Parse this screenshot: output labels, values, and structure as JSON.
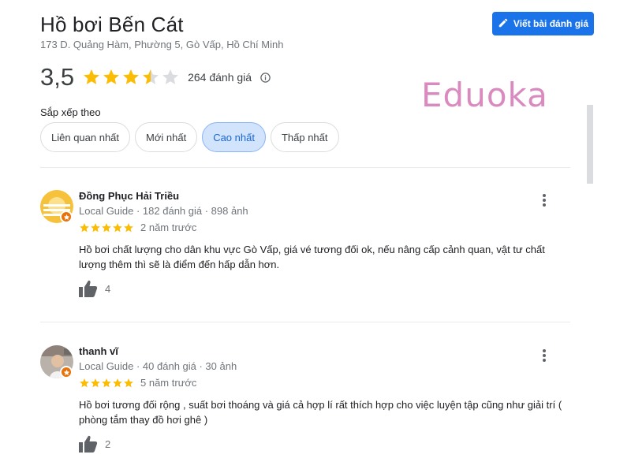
{
  "place": {
    "title": "Hồ bơi Bến Cát",
    "address": "173 D. Quảng Hàm, Phường 5, Gò Vấp, Hồ Chí Minh",
    "write_review_label": "Viết bài đánh giá"
  },
  "summary": {
    "rating": "3,5",
    "rating_value": 3.5,
    "review_count_label": "264 đánh giá"
  },
  "watermark": "Eduoka",
  "sort": {
    "label": "Sắp xếp theo",
    "options": [
      "Liên quan nhất",
      "Mới nhất",
      "Cao nhất",
      "Thấp nhất"
    ],
    "selected": "Cao nhất"
  },
  "reviews": [
    {
      "name": "Đồng Phục Hải Triều",
      "meta": "Local Guide · 182 đánh giá · 898 ảnh",
      "stars": 5,
      "time": "2 năm trước",
      "text": "Hồ bơi chất lượng cho dân khu vực Gò Vấp, giá vé tương đối ok, nếu nâng cấp cảnh quan, vật tư chất lượng thêm thì sẽ là điểm đến hấp dẫn hơn.",
      "likes": "4"
    },
    {
      "name": "thanh vĩ",
      "meta": "Local Guide · 40 đánh giá · 30 ảnh",
      "stars": 5,
      "time": "5 năm trước",
      "text": "Hồ bơi tương đối rộng , suất bơi thoáng và giá cả hợp lí rất thích hợp cho việc luyện tập cũng như giải trí ( phòng tắm thay đồ hơi ghê )",
      "likes": "2"
    }
  ],
  "colors": {
    "accent": "#1a73e8",
    "star": "#fbbc04",
    "star_empty": "#dadce0",
    "chip_selected_bg": "#d2e3fc",
    "badge": "#e8710a",
    "watermark": "#d98bbf"
  },
  "icons": {
    "write": "pencil-icon",
    "info": "info-icon",
    "more": "more-vert-icon",
    "like": "thumb-up-icon",
    "badge": "local-guide-star-icon"
  }
}
